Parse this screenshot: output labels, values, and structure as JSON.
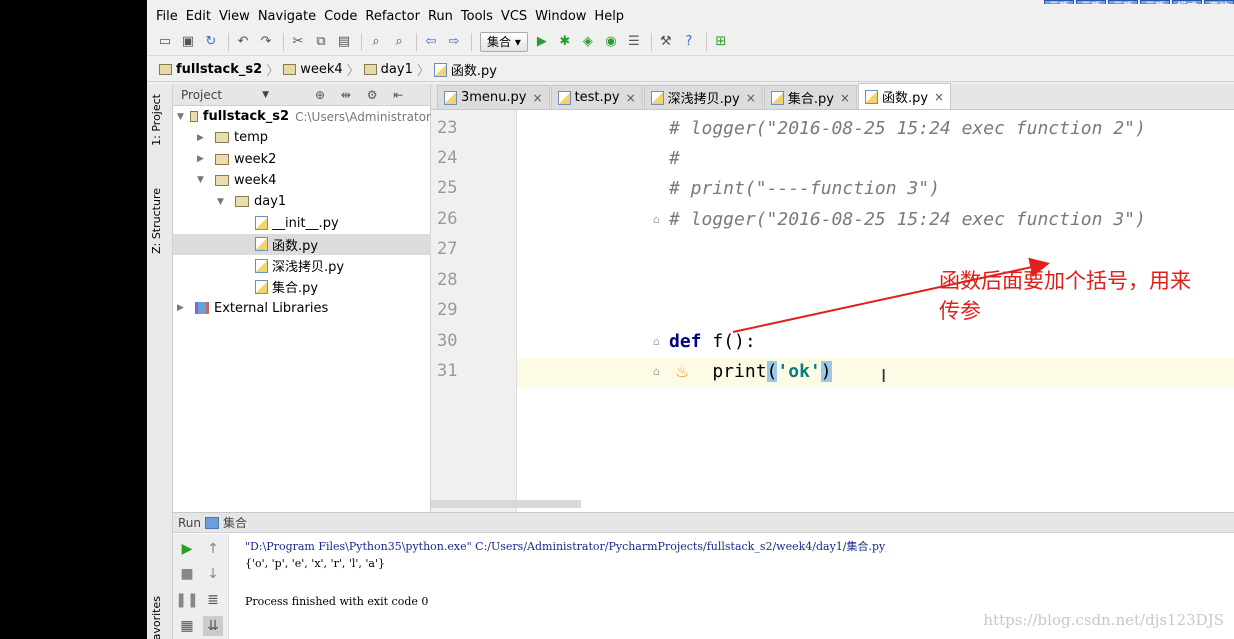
{
  "menu": [
    "File",
    "Edit",
    "View",
    "Navigate",
    "Code",
    "Refactor",
    "Run",
    "Tools",
    "VCS",
    "Window",
    "Help"
  ],
  "top_buttons": [
    "画质",
    "画质",
    "画质",
    "画质",
    "模式",
    "高效"
  ],
  "toolbar": {
    "run_config": "集合"
  },
  "breadcrumb": [
    {
      "label": "fullstack_s2",
      "bold": true
    },
    {
      "label": "week4"
    },
    {
      "label": "day1"
    },
    {
      "label": "函数.py"
    }
  ],
  "left_tabs": {
    "project": "1: Project",
    "structure": "Z: Structure",
    "favorites": "Favorites"
  },
  "project_panel": {
    "header": "Project",
    "tree": [
      {
        "label": "fullstack_s2",
        "path": "C:\\Users\\Administrator",
        "bold": true,
        "icon": "folder-icon",
        "arrow": "▼",
        "indent": 0
      },
      {
        "label": "temp",
        "icon": "folder-icon",
        "arrow": "▶",
        "indent": 1
      },
      {
        "label": "week2",
        "icon": "folder-icon",
        "arrow": "▶",
        "indent": 1
      },
      {
        "label": "week4",
        "icon": "folder-icon",
        "arrow": "▼",
        "indent": 1
      },
      {
        "label": "day1",
        "icon": "folder-icon",
        "arrow": "▼",
        "indent": 2
      },
      {
        "label": "__init__.py",
        "icon": "python-file-icon",
        "indent": 3
      },
      {
        "label": "函数.py",
        "icon": "python-file-icon",
        "indent": 3,
        "selected": true
      },
      {
        "label": "深浅拷贝.py",
        "icon": "python-file-icon",
        "indent": 3
      },
      {
        "label": "集合.py",
        "icon": "python-file-icon",
        "indent": 3
      },
      {
        "label": "External Libraries",
        "icon": "library-icon",
        "arrow": "▶",
        "indent": 0
      }
    ]
  },
  "editor_tabs": [
    {
      "label": "3menu.py"
    },
    {
      "label": "test.py"
    },
    {
      "label": "深浅拷贝.py"
    },
    {
      "label": "集合.py"
    },
    {
      "label": "函数.py",
      "active": true
    }
  ],
  "editor": {
    "lines": [
      {
        "num": "23",
        "text": "# logger(\"2016-08-25 15:24 exec function 2\")"
      },
      {
        "num": "24",
        "text": "#"
      },
      {
        "num": "25",
        "text": "# print(\"----function 3\")"
      },
      {
        "num": "26",
        "text": "# logger(\"2016-08-25 15:24 exec function 3\")"
      },
      {
        "num": "27",
        "text": ""
      },
      {
        "num": "28",
        "text": ""
      },
      {
        "num": "29",
        "text": ""
      },
      {
        "num": "30",
        "kw": "def",
        "rest": " f():"
      },
      {
        "num": "31",
        "pre": "    print",
        "paren_open": "(",
        "str": "'ok'",
        "paren_close": ")"
      }
    ],
    "annotation_line1": "函数后面要加个括号，用来",
    "annotation_line2": "传参"
  },
  "run_panel": {
    "title": "Run",
    "config": "集合",
    "output": [
      "\"D:\\Program Files\\Python35\\python.exe\" C:/Users/Administrator/PycharmProjects/fullstack_s2/week4/day1/集合.py",
      "{'o', 'p', 'e', 'x', 'r', 'l', 'a'}",
      "Process finished with exit code 0"
    ]
  },
  "watermark": "https://blog.csdn.net/djs123DJS"
}
